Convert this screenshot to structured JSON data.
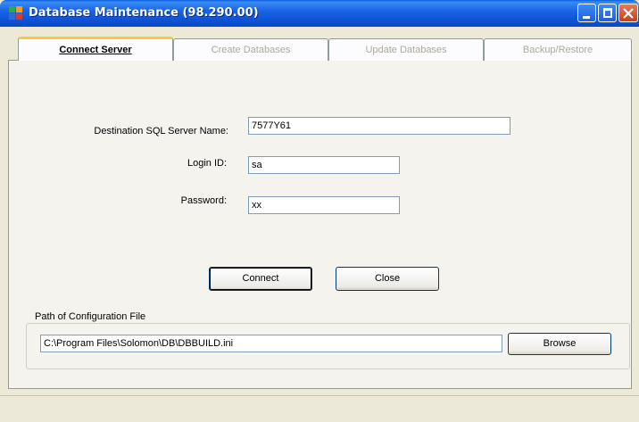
{
  "window": {
    "title": "Database Maintenance (98.290.00)"
  },
  "tabs": [
    {
      "label": "Connect Server",
      "active": true
    },
    {
      "label": "Create Databases",
      "active": false
    },
    {
      "label": "Update Databases",
      "active": false
    },
    {
      "label": "Backup/Restore",
      "active": false
    }
  ],
  "form": {
    "server_label": "Destination SQL Server Name:",
    "server_value": "7577Y61",
    "login_label": "Login ID:",
    "login_value": "sa",
    "password_label": "Password:",
    "password_value": "xx"
  },
  "buttons": {
    "connect": "Connect",
    "close": "Close",
    "browse": "Browse"
  },
  "config": {
    "legend": "Path of Configuration File",
    "path_value": "C:\\Program Files\\Solomon\\DB\\DBBUILD.ini"
  },
  "icons": {
    "app": "database-app-icon",
    "minimize": "minimize-icon",
    "maximize": "maximize-icon",
    "close": "close-icon"
  },
  "colors": {
    "titlebar": "#0a5fe0",
    "active_tab_accent": "#ffc83c",
    "close_button": "#c4401c"
  }
}
